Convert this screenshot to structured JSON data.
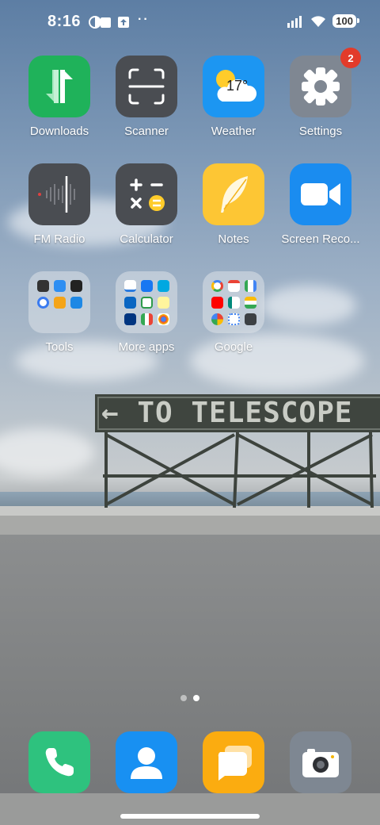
{
  "status_bar": {
    "time": "8:16",
    "battery": "100"
  },
  "sign": {
    "text": "← TO TELESCOPE"
  },
  "apps": [
    {
      "label": "Downloads",
      "color": "#1fb25a",
      "icon": "downloads-icon"
    },
    {
      "label": "Scanner",
      "color": "#4a4d52",
      "icon": "scanner-icon"
    },
    {
      "label": "Weather",
      "color": "#1c96f2",
      "icon": "weather-icon",
      "temp": "17°"
    },
    {
      "label": "Settings",
      "color": "#7f8792",
      "icon": "gear-icon",
      "badge": "2"
    },
    {
      "label": "FM Radio",
      "color": "#4a4d52",
      "icon": "radio-icon"
    },
    {
      "label": "Calculator",
      "color": "#4a4d52",
      "icon": "calculator-icon"
    },
    {
      "label": "Notes",
      "color": "#fdc634",
      "icon": "feather-icon"
    },
    {
      "label": "Screen Reco...",
      "color": "#1a8cf0",
      "icon": "video-camera-icon"
    }
  ],
  "folders": [
    {
      "label": "Tools"
    },
    {
      "label": "More apps"
    },
    {
      "label": "Google"
    }
  ],
  "dock": [
    {
      "name": "phone",
      "color": "#2ec27e",
      "icon": "phone-icon"
    },
    {
      "name": "contacts",
      "color": "#1890f2",
      "icon": "contact-icon"
    },
    {
      "name": "messages",
      "color": "#fbac10",
      "icon": "message-icon"
    },
    {
      "name": "camera",
      "color": "#7e8792",
      "icon": "camera-icon"
    }
  ],
  "page_indicator": {
    "total": 2,
    "active": 2
  }
}
